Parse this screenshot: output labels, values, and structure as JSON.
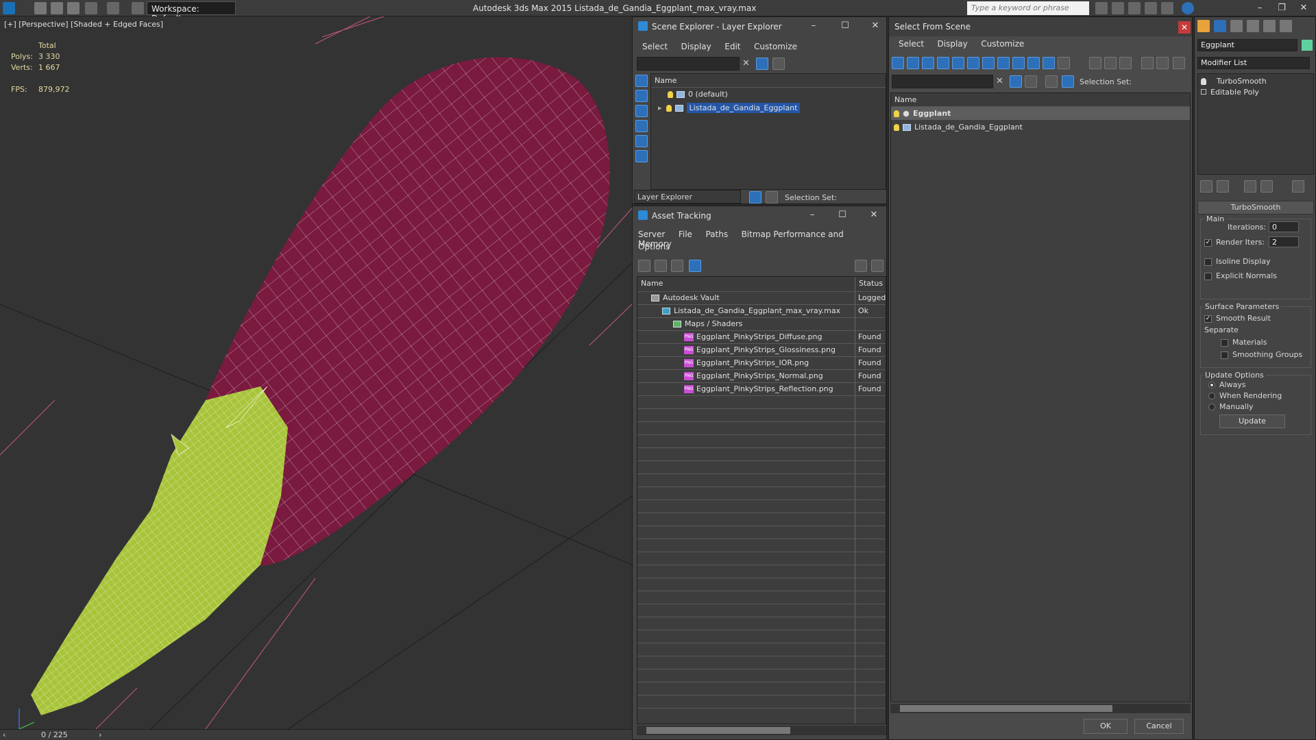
{
  "app": {
    "title": "Autodesk 3ds Max  2015    Listada_de_Gandia_Eggplant_max_vray.max",
    "workspace": "Workspace: Default",
    "search_placeholder": "Type a keyword or phrase"
  },
  "viewport": {
    "label": "[+] [Perspective] [Shaded + Edged Faces]",
    "stats": {
      "total_label": "Total",
      "polys_label": "Polys:",
      "polys_value": "3 330",
      "verts_label": "Verts:",
      "verts_value": "1 667",
      "fps_label": "FPS:",
      "fps_value": "879,972"
    },
    "timeline": "0 / 225"
  },
  "scene_explorer": {
    "title": "Scene Explorer - Layer Explorer",
    "menu": [
      "Select",
      "Display",
      "Edit",
      "Customize"
    ],
    "column": "Name",
    "rows": [
      {
        "name": "0 (default)",
        "selected": false
      },
      {
        "name": "Listada_de_Gandia_Eggplant",
        "selected": true
      }
    ],
    "footer_dropdown": "Layer Explorer",
    "footer_selection": "Selection Set:"
  },
  "asset_tracking": {
    "title": "Asset Tracking",
    "menu": [
      "Server",
      "File",
      "Paths",
      "Bitmap Performance and Memory"
    ],
    "menu2": "Options",
    "columns": [
      "Name",
      "Status"
    ],
    "rows": [
      {
        "name": "Autodesk Vault",
        "status": "Logged",
        "indent": 0
      },
      {
        "name": "Listada_de_Gandia_Eggplant_max_vray.max",
        "status": "Ok",
        "indent": 1
      },
      {
        "name": "Maps / Shaders",
        "status": "",
        "indent": 2
      },
      {
        "name": "Eggplant_PinkyStrips_Diffuse.png",
        "status": "Found",
        "indent": 3
      },
      {
        "name": "Eggplant_PinkyStrips_Glossiness.png",
        "status": "Found",
        "indent": 3
      },
      {
        "name": "Eggplant_PinkyStrips_IOR.png",
        "status": "Found",
        "indent": 3
      },
      {
        "name": "Eggplant_PinkyStrips_Normal.png",
        "status": "Found",
        "indent": 3
      },
      {
        "name": "Eggplant_PinkyStrips_Reflection.png",
        "status": "Found",
        "indent": 3
      }
    ]
  },
  "select_from_scene": {
    "title": "Select From Scene",
    "menu": [
      "Select",
      "Display",
      "Customize"
    ],
    "selection_set": "Selection Set:",
    "column": "Name",
    "rows": [
      {
        "name": "Eggplant",
        "selected": true
      },
      {
        "name": "Listada_de_Gandia_Eggplant",
        "selected": false
      }
    ],
    "ok": "OK",
    "cancel": "Cancel"
  },
  "command_panel": {
    "object_name": "Eggplant",
    "modifier_list": "Modifier List",
    "stack": [
      "TurboSmooth",
      "Editable Poly"
    ],
    "rollout": "TurboSmooth",
    "main_label": "Main",
    "iterations_label": "Iterations:",
    "iterations_value": "0",
    "render_iters_label": "Render Iters:",
    "render_iters_value": "2",
    "isoline": "Isoline Display",
    "explicit_normals": "Explicit Normals",
    "surface_params": "Surface Parameters",
    "smooth_result": "Smooth Result",
    "separate": "Separate",
    "materials": "Materials",
    "smoothing_groups": "Smoothing Groups",
    "update_options": "Update Options",
    "always": "Always",
    "when_rendering": "When Rendering",
    "manually": "Manually",
    "update_button": "Update"
  },
  "colors": {
    "eggplant": "#7a1a3f",
    "calyx": "#a8c43a",
    "selection": "#2456a8"
  }
}
